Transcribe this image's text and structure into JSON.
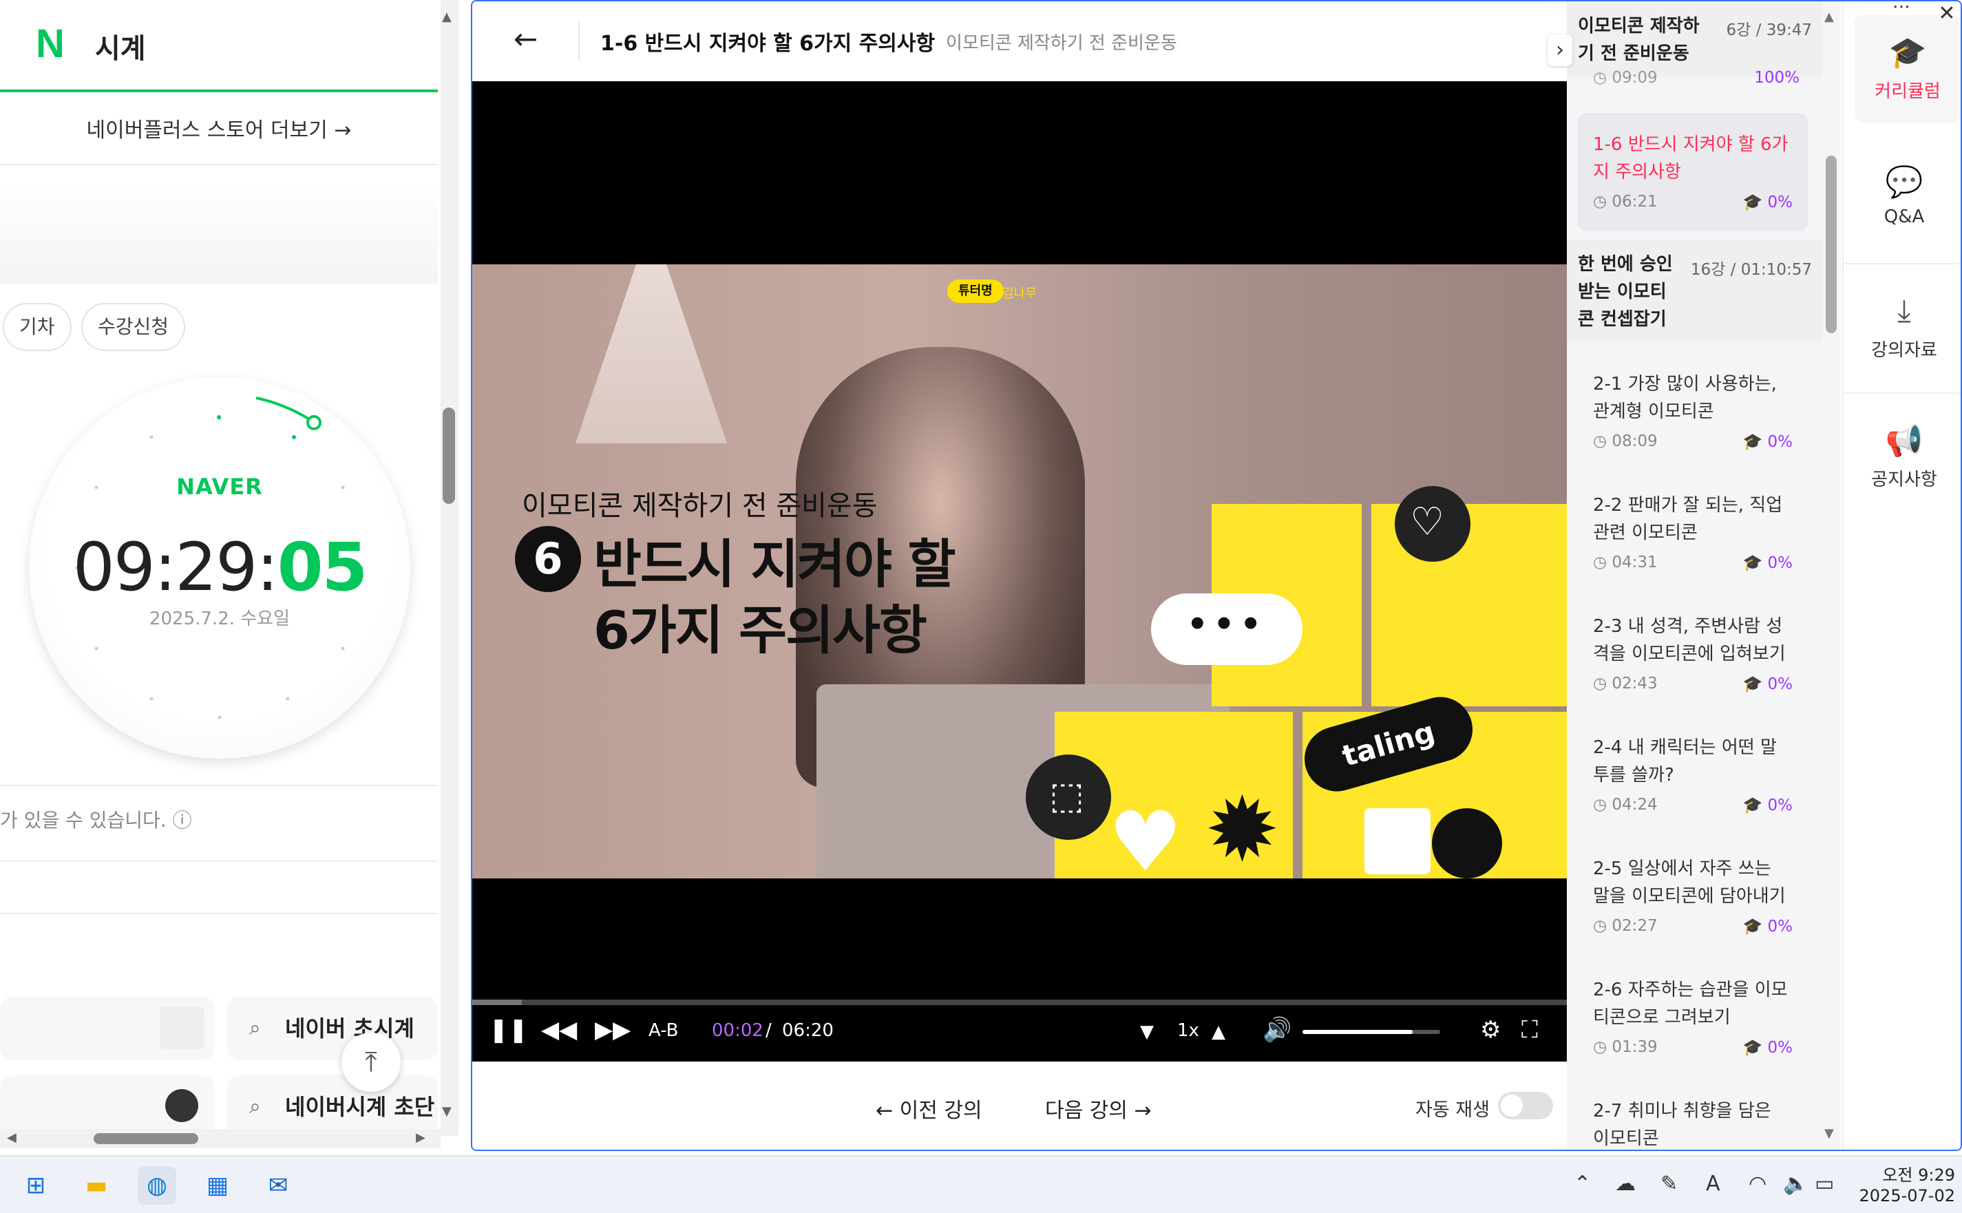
{
  "left_panel": {
    "app_title": "시계",
    "store_link": "네이버플러스 스토어 더보기 →",
    "chips": [
      "기차",
      "수강신청"
    ],
    "clock_brand": "NAVER",
    "time_hm": "09:29:",
    "time_sec": "05",
    "date": "2025.7.2. 수요일",
    "notice": "가 있을 수 있습니다. ⓘ",
    "search_results": [
      "네이버 초시계",
      "네이버시계 초단"
    ]
  },
  "header": {
    "back": "←",
    "lecture_title": "1-6 반드시 지켜야 할 6가지 주의사항",
    "section_subtitle": "이모티콘 제작하기 전 준비운동"
  },
  "video": {
    "tutor_badge": "튜터명",
    "tutor_name": "김나무",
    "subtitle": "이모티콘 제작하기 전 준비운동",
    "number": "6",
    "title_line1": "반드시 지켜야 할",
    "title_line2": "6가지 주의사항",
    "bubble": "•••",
    "brand": "taling"
  },
  "controls": {
    "ab": "A-B",
    "current_time": "00:02",
    "separator": "/",
    "duration": "06:20",
    "speed": "1x",
    "progress_fraction": 0.045,
    "volume_fraction": 0.8
  },
  "bottom": {
    "prev": "← 이전 강의",
    "next": "다음 강의 →",
    "autoplay_label": "자동 재생"
  },
  "curriculum": {
    "sections": [
      {
        "title": "이모티콘 제작하\n기 전 준비운동",
        "meta": "6강 / 39:47"
      },
      {
        "title": "한 번에 승인\n받는 이모티\n콘 컨셉잡기",
        "meta": "16강 / 01:10:57"
      }
    ],
    "partial_item": {
      "time": "09:09",
      "pct": "100%"
    },
    "active_item": {
      "title": "1-6 반드시 지켜야 할 6가지 주의사항",
      "time": "06:21",
      "pct": "0%"
    },
    "items": [
      {
        "title": "2-1 가장 많이 사용하는, 관계형 이모티콘",
        "time": "08:09",
        "pct": "0%"
      },
      {
        "title": "2-2 판매가 잘 되는, 직업 관련 이모티콘",
        "time": "04:31",
        "pct": "0%"
      },
      {
        "title": "2-3 내 성격, 주변사람 성격을 이모티콘에 입혀보기",
        "time": "02:43",
        "pct": "0%"
      },
      {
        "title": "2-4 내 캐릭터는 어떤 말투를 쓸까?",
        "time": "04:24",
        "pct": "0%"
      },
      {
        "title": "2-5 일상에서 자주 쓰는 말을 이모티콘에 담아내기",
        "time": "02:27",
        "pct": "0%"
      },
      {
        "title": "2-6 자주하는 습관을 이모티콘으로 그려보기",
        "time": "01:39",
        "pct": "0%"
      },
      {
        "title": "2-7 취미나 취향을 담은 이모티콘",
        "time": "",
        "pct": ""
      }
    ]
  },
  "sidebar": {
    "items": [
      {
        "label": "커리큘럼",
        "icon": "graduation-cap-icon"
      },
      {
        "label": "Q&A",
        "icon": "chat-bubble-icon"
      },
      {
        "label": "강의자료",
        "icon": "download-icon"
      },
      {
        "label": "공지사항",
        "icon": "megaphone-icon"
      }
    ]
  },
  "taskbar": {
    "clock_time": "오전 9:29",
    "clock_date": "2025-07-02"
  },
  "colors": {
    "naver_green": "#03c75a",
    "accent_pink": "#ff2d55",
    "progress_purple": "#9a35ff",
    "video_yellow": "#ffe62a",
    "focus_blue": "#3b6ef5"
  }
}
